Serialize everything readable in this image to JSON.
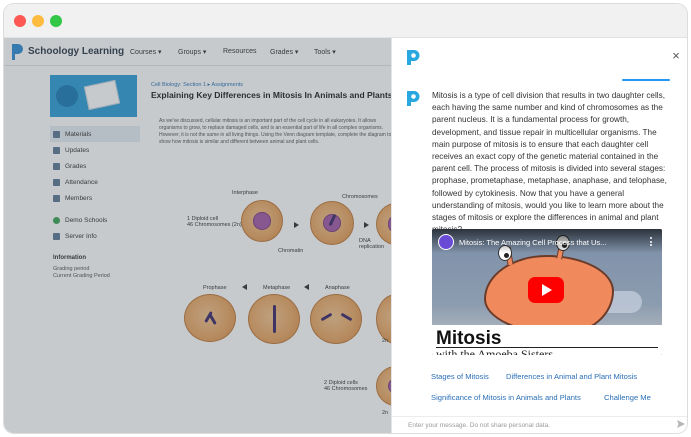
{
  "window": {
    "controls": [
      "close",
      "minimize",
      "maximize"
    ]
  },
  "lms": {
    "brand": "Schoology Learning",
    "nav": [
      "Courses ▾",
      "Groups ▾",
      "Resources",
      "Grades ▾",
      "Tools ▾"
    ],
    "breadcrumb": "Cell Biology: Section 1  ▸  Assignments",
    "page_title": "Explaining Key Differences in Mitosis In Animals and Plants",
    "body_text": "As we've discussed, cellular mitosis is an important part of the cell cycle in all eukaryotes. It allows organisms to grow, to replace damaged cells, and is an essential part of life in all complex organisms. However, it is not the same in all living things. Using the Venn diagram template, complete the diagram to show how mitosis is similar and different between animal and plant cells.",
    "sidebar": [
      {
        "label": "Materials",
        "icon": "materials-icon",
        "active": true
      },
      {
        "label": "Updates",
        "icon": "updates-icon"
      },
      {
        "label": "Grades",
        "icon": "grades-icon"
      },
      {
        "label": "Attendance",
        "icon": "attendance-icon"
      },
      {
        "label": "Members",
        "icon": "members-icon"
      },
      {
        "label": "Demo Schools",
        "icon": "school-icon"
      },
      {
        "label": "Server Info",
        "icon": "chart-icon"
      }
    ],
    "info": {
      "heading": "Information",
      "lines": [
        "Grading period",
        "Current Grading Period"
      ]
    },
    "diagram": {
      "interphase": "Interphase",
      "chromosomes": "Chromosomes",
      "chromatin": "Chromatin",
      "dna_replication": "DNA\nreplication",
      "diploid_top": "1 Diploid cell\n46 Chromosomes (2n)",
      "prophase": "Prophase",
      "metaphase": "Metaphase",
      "anaphase": "Anaphase",
      "diploid_bottom": "2 Diploid cells\n46 Chromosomes",
      "twon_1": "2n",
      "twon_2": "2n"
    }
  },
  "chat": {
    "message": "Mitosis is a type of cell division that results in two daughter cells, each having the same number and kind of chromosomes as the parent nucleus. It is a fundamental process for growth, development, and tissue repair in multicellular organisms. The main purpose of mitosis is to ensure that each daughter cell receives an exact copy of the genetic material contained in the parent cell. The process of mitosis is divided into several stages: prophase, prometaphase, metaphase, anaphase, and telophase, followed by cytokinesis. Now that you have a general understanding of mitosis, would you like to learn more about the stages of mitosis or explore the differences in animal and plant mitosis?",
    "video": {
      "title": "Mitosis: The Amazing Cell Process that Us...",
      "caption_big": "Mitosis",
      "caption_small": "with the Amoeba Sisters"
    },
    "suggestions": [
      "Stages of Mitosis",
      "Differences in Animal and Plant Mitosis",
      "Significance of Mitosis in Animals and Plants",
      "Challenge Me"
    ],
    "input_placeholder": "Enter your message. Do not share personal data.",
    "colors": {
      "accent": "#2196f3",
      "link": "#2a6fb5",
      "logo": "#29a8e0"
    }
  }
}
